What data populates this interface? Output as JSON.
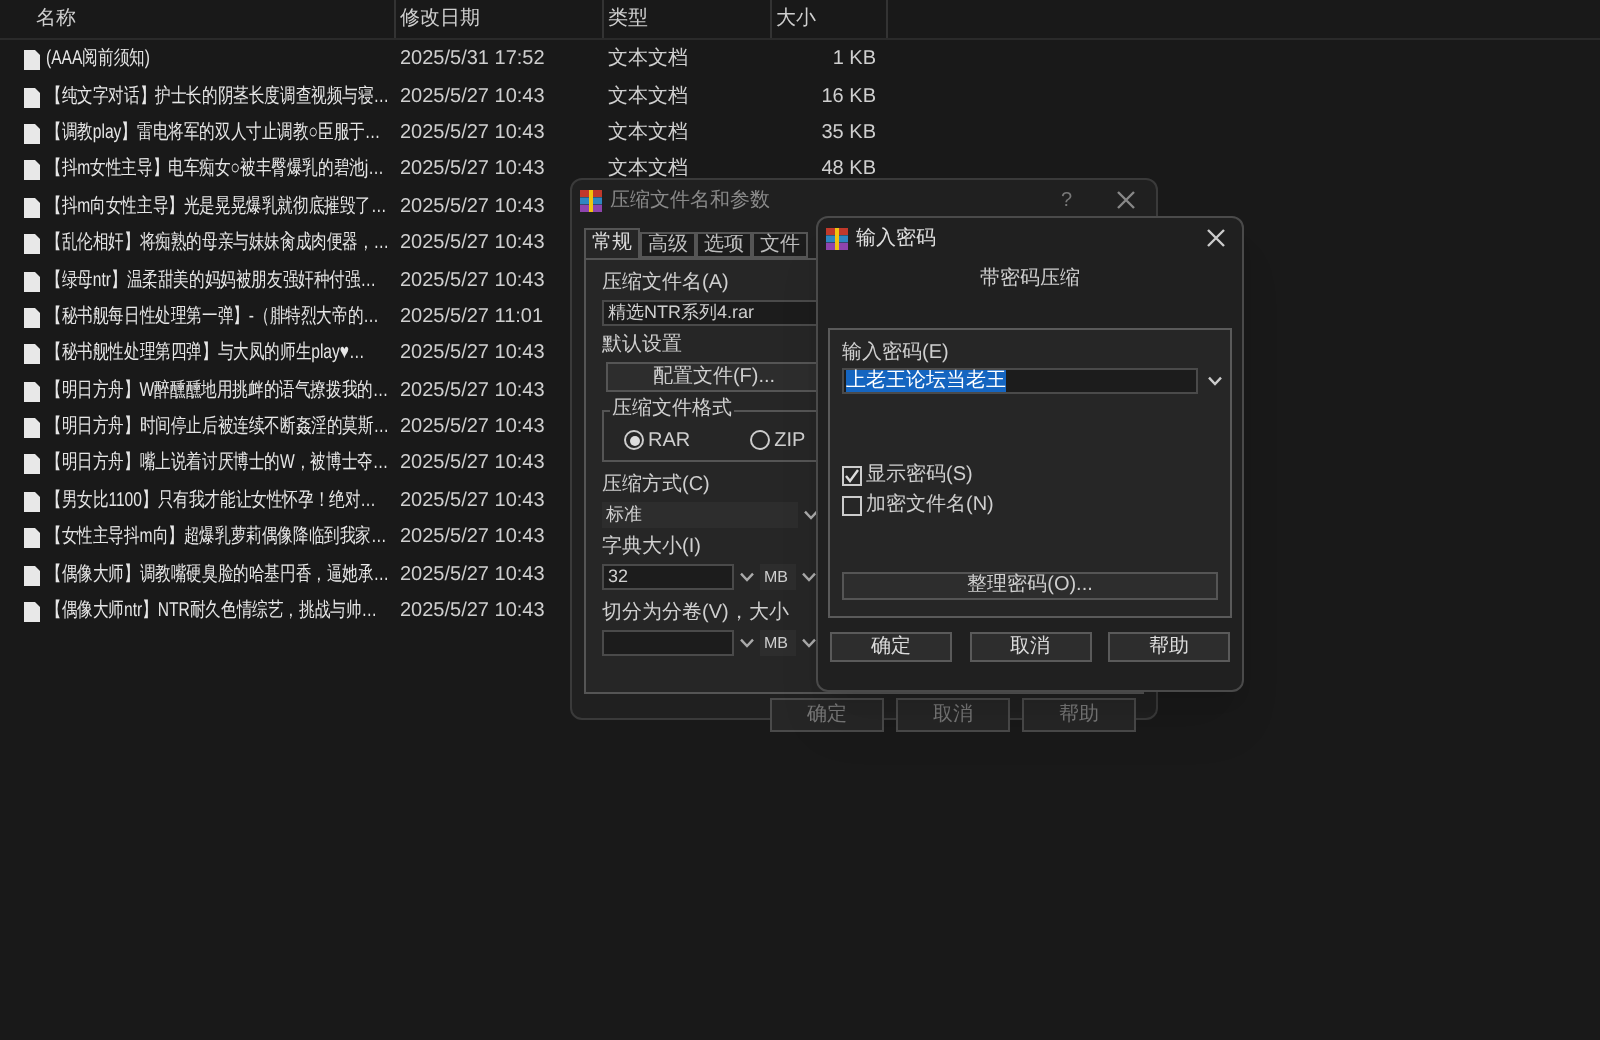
{
  "file_list": {
    "columns": [
      "名称",
      "修改日期",
      "类型",
      "大小"
    ],
    "rows": [
      {
        "name": "(AAA阅前须知)",
        "date": "2025/5/31 17:52",
        "type": "文本文档",
        "size": "1 KB"
      },
      {
        "name": "【纯文字对话】护士长的阴茎长度调查视频与寝…",
        "date": "2025/5/27 10:43",
        "type": "文本文档",
        "size": "16 KB"
      },
      {
        "name": "【调教play】雷电将军的双人寸止调教○臣服于…",
        "date": "2025/5/27 10:43",
        "type": "文本文档",
        "size": "35 KB"
      },
      {
        "name": "【抖m女性主导】电车痴女○被丰臀爆乳的碧池j…",
        "date": "2025/5/27 10:43",
        "type": "文本文档",
        "size": "48 KB"
      },
      {
        "name": "【抖m向女性主导】光是晃晃爆乳就彻底摧毁了…",
        "date": "2025/5/27 10:43"
      },
      {
        "name": "【乱伦相奸】将痴熟的母亲与妹妹肏成肉便器，…",
        "date": "2025/5/27 10:43"
      },
      {
        "name": "【绿母ntr】温柔甜美的妈妈被朋友强奸种付强…",
        "date": "2025/5/27 10:43"
      },
      {
        "name": "【秘书舰每日性处理第一弹】-（腓特烈大帝的…",
        "date": "2025/5/27 11:01"
      },
      {
        "name": "【秘书舰性处理第四弹】与大凤的师生play♥…",
        "date": "2025/5/27 10:43"
      },
      {
        "name": "【明日方舟】W醉醺醺地用挑衅的语气撩拨我的…",
        "date": "2025/5/27 10:43"
      },
      {
        "name": "【明日方舟】时间停止后被连续不断姦淫的莫斯…",
        "date": "2025/5/27 10:43"
      },
      {
        "name": "【明日方舟】嘴上说着讨厌博士的W，被博士夺…",
        "date": "2025/5/27 10:43"
      },
      {
        "name": "【男女比1100】只有我才能让女性怀孕！绝对…",
        "date": "2025/5/27 10:43"
      },
      {
        "name": "【女性主导抖m向】超爆乳萝莉偶像降临到我家…",
        "date": "2025/5/27 10:43"
      },
      {
        "name": "【偶像大师】调教嘴硬臭脸的哈基円香，逼她承…",
        "date": "2025/5/27 10:43"
      },
      {
        "name": "【偶像大师ntr】NTR耐久色情综艺，挑战与帅…",
        "date": "2025/5/27 10:43"
      }
    ]
  },
  "compress_dialog": {
    "title": "压缩文件名和参数",
    "help": "?",
    "tabs": [
      {
        "label": "常规",
        "selected": true
      },
      {
        "label": "高级",
        "selected": false
      },
      {
        "label": "选项",
        "selected": false
      },
      {
        "label": "文件",
        "selected": false
      }
    ],
    "archive_name_label": "压缩文件名(A)",
    "archive_name": "精选NTR系列4.rar",
    "profile_label": "默认设置",
    "profile_button": "配置文件(F)...",
    "format_group": "压缩文件格式",
    "formats": [
      {
        "label": "RAR",
        "selected": true
      },
      {
        "label": "ZIP",
        "selected": false
      }
    ],
    "method_label": "压缩方式(C)",
    "method": "标准",
    "dict_label": "字典大小(I)",
    "dict_size": "32",
    "dict_unit": "MB",
    "split_label": "切分为分卷(V)，大小",
    "split_unit": "MB",
    "buttons": [
      "确定",
      "取消",
      "帮助"
    ]
  },
  "password_dialog": {
    "title": "输入密码",
    "subtitle": "带密码压缩",
    "password_label": "输入密码(E)",
    "password": "上老王论坛当老王",
    "checkboxes": [
      {
        "label": "显示密码(S)",
        "checked": true
      },
      {
        "label": "加密文件名(N)",
        "checked": false
      }
    ],
    "manage_button": "整理密码(O)...",
    "buttons": [
      "确定",
      "取消",
      "帮助"
    ]
  }
}
